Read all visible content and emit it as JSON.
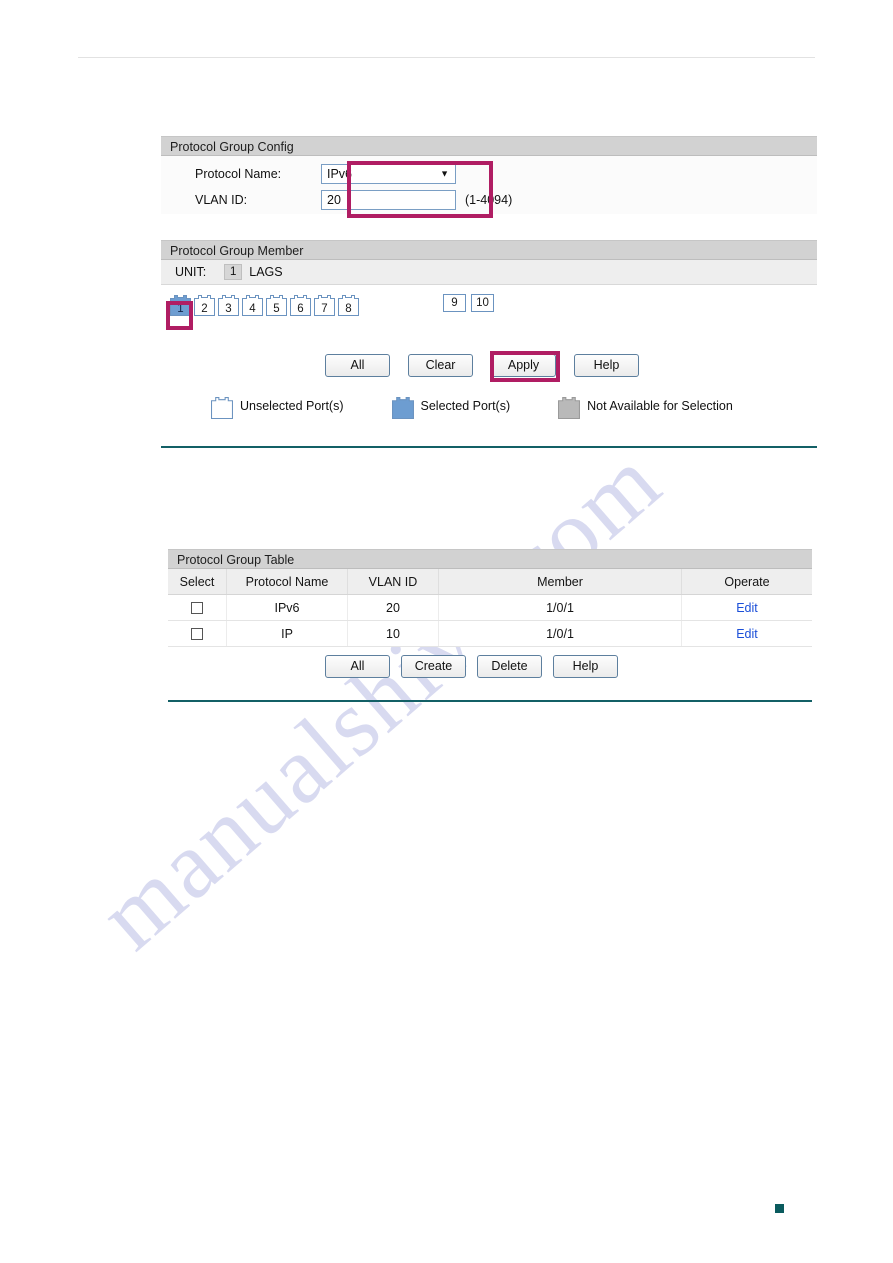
{
  "config_section": {
    "title": "Protocol Group Config",
    "protocol_name_label": "Protocol Name:",
    "protocol_name_value": "IPv6",
    "vlan_id_label": "VLAN ID:",
    "vlan_id_value": "20",
    "vlan_id_hint": "(1-4094)"
  },
  "member_section": {
    "title": "Protocol Group Member",
    "unit_label": "UNIT:",
    "unit_value": "1",
    "lags_label": "LAGS",
    "ports": [
      {
        "num": "1",
        "state": "selected"
      },
      {
        "num": "2",
        "state": "unselected"
      },
      {
        "num": "3",
        "state": "unselected"
      },
      {
        "num": "4",
        "state": "unselected"
      },
      {
        "num": "5",
        "state": "unselected"
      },
      {
        "num": "6",
        "state": "unselected"
      },
      {
        "num": "7",
        "state": "unselected"
      },
      {
        "num": "8",
        "state": "unselected"
      }
    ],
    "lag_ports": [
      {
        "num": "9"
      },
      {
        "num": "10"
      }
    ],
    "buttons": [
      {
        "label": "All"
      },
      {
        "label": "Clear"
      },
      {
        "label": "Apply"
      },
      {
        "label": "Help"
      }
    ],
    "legend": [
      {
        "label": "Unselected Port(s)",
        "state": "unselected"
      },
      {
        "label": "Selected Port(s)",
        "state": "selected"
      },
      {
        "label": "Not Available for Selection",
        "state": "unavailable"
      }
    ]
  },
  "table_section": {
    "title": "Protocol Group Table",
    "columns": [
      "Select",
      "Protocol Name",
      "VLAN ID",
      "Member",
      "Operate"
    ],
    "rows": [
      {
        "protocol_name": "IPv6",
        "vlan_id": "20",
        "member": "1/0/1",
        "operate": "Edit"
      },
      {
        "protocol_name": "IP",
        "vlan_id": "10",
        "member": "1/0/1",
        "operate": "Edit"
      }
    ],
    "buttons": [
      {
        "label": "All"
      },
      {
        "label": "Create"
      },
      {
        "label": "Delete"
      },
      {
        "label": "Help"
      }
    ]
  },
  "watermark": {
    "text": "manualshive.com"
  },
  "colors": {
    "callout": "#b01d63",
    "rule_teal": "#136066",
    "panel_header": "#d2d2d2",
    "port_selected": "#6d9dd1",
    "port_border": "#6b93c0",
    "link": "#1b4fd8",
    "corner_mark": "#0a5b5e"
  }
}
